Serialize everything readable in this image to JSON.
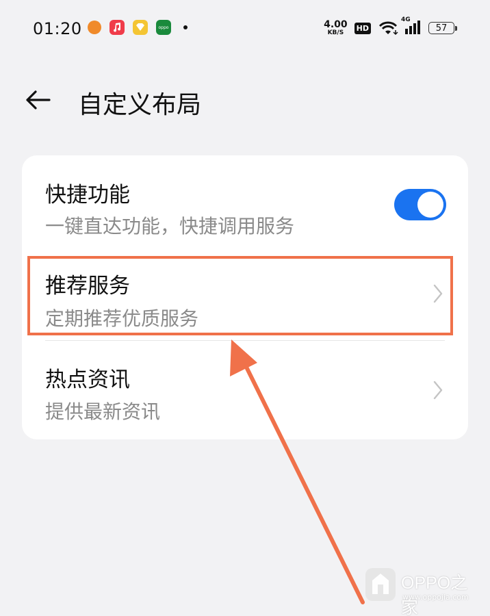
{
  "status_bar": {
    "time": "01:20",
    "speed_value": "4.00",
    "speed_unit": "KB/S",
    "hd": "HD",
    "network": "4G",
    "battery": "57",
    "notif_icons": [
      "ele-me-icon",
      "music-icon",
      "wallet-icon",
      "oppo-icon"
    ]
  },
  "header": {
    "title": "自定义布局"
  },
  "settings": [
    {
      "title": "快捷功能",
      "subtitle": "一键直达功能，快捷调用服务",
      "control": "toggle",
      "enabled": true
    },
    {
      "title": "推荐服务",
      "subtitle": "定期推荐优质服务",
      "control": "chevron"
    },
    {
      "title": "热点资讯",
      "subtitle": "提供最新资讯",
      "control": "chevron"
    }
  ],
  "annotation": {
    "highlight_color": "#f0714a"
  },
  "watermark": {
    "name": "OPPO之家",
    "url": "www.oppojia.com"
  },
  "colors": {
    "accent": "#1a73f0",
    "background": "#f2f2f4",
    "card": "#ffffff"
  }
}
